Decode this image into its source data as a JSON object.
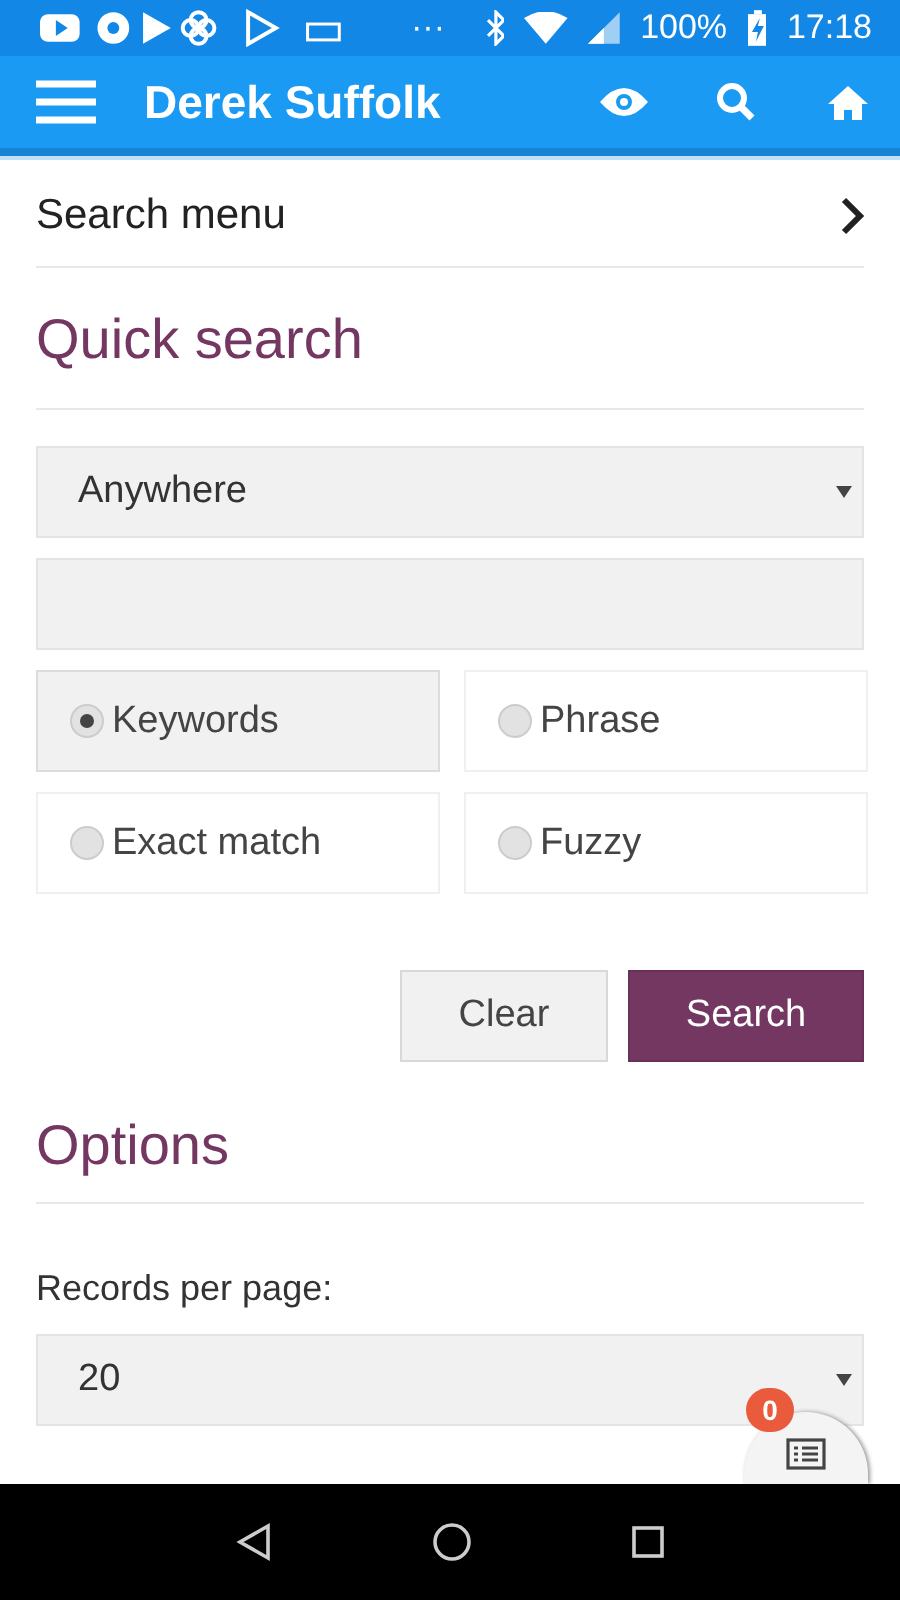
{
  "status_bar": {
    "dots": "···",
    "battery": "100%",
    "time": "17:18"
  },
  "app_bar": {
    "title": "Derek Suffolk"
  },
  "search_menu": {
    "label": "Search menu"
  },
  "quick_search": {
    "heading": "Quick search",
    "scope": "Anywhere",
    "modes": [
      {
        "label": "Keywords",
        "selected": true
      },
      {
        "label": "Phrase",
        "selected": false
      },
      {
        "label": "Exact match",
        "selected": false
      },
      {
        "label": "Fuzzy",
        "selected": false
      }
    ],
    "buttons": [
      {
        "label": "Clear",
        "kind": "secondary"
      },
      {
        "label": "Search",
        "kind": "primary"
      }
    ]
  },
  "options": {
    "heading": "Options",
    "records_label": "Records per page:",
    "records_value": "20"
  },
  "fab": {
    "badge": "0"
  }
}
